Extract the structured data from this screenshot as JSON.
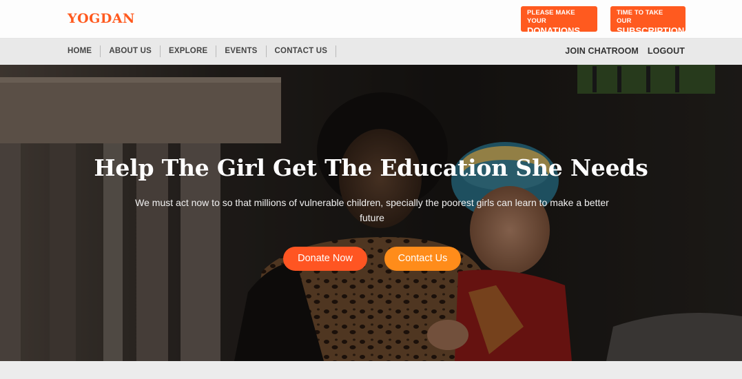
{
  "header": {
    "logo": "YOGDAN",
    "donations_cta": {
      "line1": "PLEASE MAKE YOUR",
      "line2": "DONATIONS"
    },
    "subscription_cta": {
      "line1": "TIME TO TAKE OUR",
      "line2": "SUBSCRIPTION"
    }
  },
  "nav": {
    "items": [
      {
        "label": "HOME"
      },
      {
        "label": "ABOUT US"
      },
      {
        "label": "EXPLORE"
      },
      {
        "label": "EVENTS"
      },
      {
        "label": "CONTACT US"
      }
    ],
    "join_chatroom": "JOIN CHATROOM",
    "logout": "LOGOUT"
  },
  "hero": {
    "title": "Help The Girl Get The Education She Needs",
    "subtitle": "We must act now to so that millions of vulnerable children, specially the poorest girls can learn to make a better future",
    "donate_button": "Donate Now",
    "contact_button": "Contact Us"
  },
  "colors": {
    "brand": "#ff5a1f",
    "donate_button": "#ff5522",
    "contact_button": "#ff8c1a"
  }
}
